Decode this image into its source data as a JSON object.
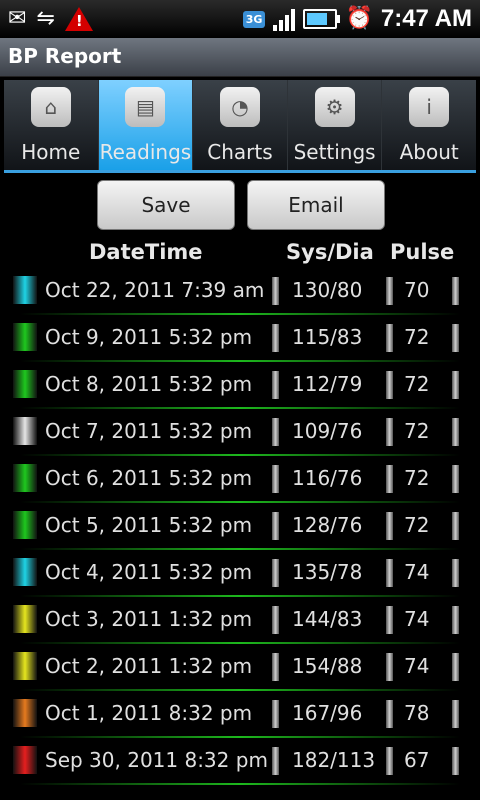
{
  "status_bar": {
    "time": "7:47 AM",
    "network": "3G"
  },
  "app_title": "BP Report",
  "tabs": [
    {
      "label": "Home",
      "icon": "home-icon"
    },
    {
      "label": "Readings",
      "icon": "document-icon"
    },
    {
      "label": "Charts",
      "icon": "pie-chart-icon"
    },
    {
      "label": "Settings",
      "icon": "gear-icon"
    },
    {
      "label": "About",
      "icon": "info-icon"
    }
  ],
  "active_tab": "Readings",
  "buttons": {
    "save": "Save",
    "email": "Email"
  },
  "columns": {
    "datetime": "DateTime",
    "sysdia": "Sys/Dia",
    "pulse": "Pulse"
  },
  "readings": [
    {
      "datetime": "Oct 22, 2011 7:39 am",
      "sysdia": "130/80",
      "pulse": "70",
      "color": "#1fd3e6"
    },
    {
      "datetime": "Oct 9, 2011 5:32 pm",
      "sysdia": "115/83",
      "pulse": "72",
      "color": "#1ec81e"
    },
    {
      "datetime": "Oct 8, 2011 5:32 pm",
      "sysdia": "112/79",
      "pulse": "72",
      "color": "#1ec81e"
    },
    {
      "datetime": "Oct 7, 2011 5:32 pm",
      "sysdia": "109/76",
      "pulse": "72",
      "color": "#e6e6e6"
    },
    {
      "datetime": "Oct 6, 2011 5:32 pm",
      "sysdia": "116/76",
      "pulse": "72",
      "color": "#1ec81e"
    },
    {
      "datetime": "Oct 5, 2011 5:32 pm",
      "sysdia": "128/76",
      "pulse": "72",
      "color": "#1ec81e"
    },
    {
      "datetime": "Oct 4, 2011 5:32 pm",
      "sysdia": "135/78",
      "pulse": "74",
      "color": "#1fd3e6"
    },
    {
      "datetime": "Oct 3, 2011 1:32 pm",
      "sysdia": "144/83",
      "pulse": "74",
      "color": "#e6e61f"
    },
    {
      "datetime": "Oct 2, 2011 1:32 pm",
      "sysdia": "154/88",
      "pulse": "74",
      "color": "#e6e61f"
    },
    {
      "datetime": "Oct 1, 2011 8:32 pm",
      "sysdia": "167/96",
      "pulse": "78",
      "color": "#e67a1f"
    },
    {
      "datetime": "Sep 30, 2011 8:32 pm",
      "sysdia": "182/113",
      "pulse": "67",
      "color": "#e61f1f"
    }
  ]
}
